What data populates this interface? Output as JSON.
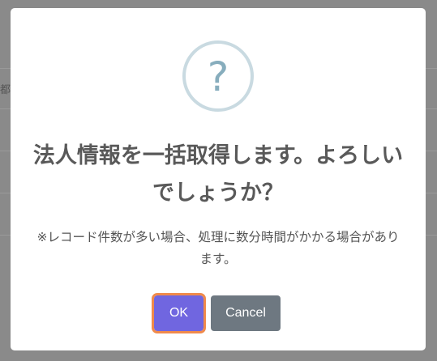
{
  "background": {
    "partial_text": "都"
  },
  "dialog": {
    "icon": "question-icon",
    "icon_glyph": "?",
    "title": "法人情報を一括取得します。よろしいでしょうか？",
    "message": "※レコード件数が多い場合、処理に数分時間がかかる場合があります。",
    "confirm_label": "OK",
    "cancel_label": "Cancel",
    "colors": {
      "confirm": "#7066e0",
      "cancel": "#6e7881",
      "focus_ring": "#f08a4b",
      "icon_ring": "#c9dae1",
      "icon_glyph": "#87adbd"
    }
  }
}
